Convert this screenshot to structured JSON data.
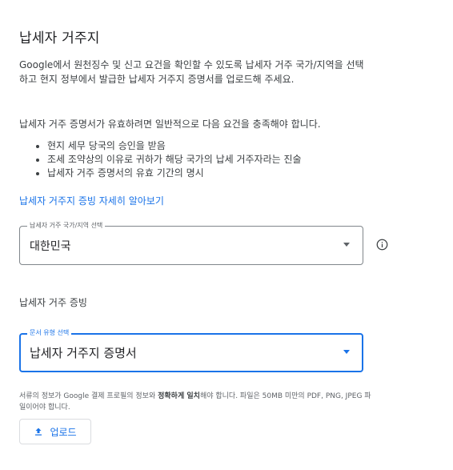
{
  "title": "납세자 거주지",
  "description": "Google에서 원천징수 및 신고 요건을 확인할 수 있도록 납세자 거주 국가/지역을 선택하고 현지 정부에서 발급한 납세자 거주지 증명서를 업로드해 주세요.",
  "requirements": {
    "intro": "납세자 거주 증명서가 유효하려면 일반적으로 다음 요건을 충족해야 합니다.",
    "items": [
      "현지 세무 당국의 승인을 받음",
      "조세 조약상의 이유로 귀하가 해당 국가의 납세 거주자라는 진술",
      "납세자 거주 증명서의 유효 기간의 명시"
    ]
  },
  "learn_more_link": "납세자 거주지 증빙 자세히 알아보기",
  "country_select": {
    "label": "납세자 거주 국가/지역 선택",
    "value": "대한민국"
  },
  "proof": {
    "label": "납세자 거주 증빙"
  },
  "doc_type_select": {
    "label": "문서 유형 선택",
    "value": "납세자 거주지 증명서"
  },
  "note": {
    "part1": "서류의 정보가 Google 결제 프로필의 정보와 ",
    "bold": "정확하게 일치",
    "part2": "해야 합니다. 파일은 50MB 미만의 PDF, PNG, JPEG 파일이어야 합니다."
  },
  "upload_button": {
    "label": "업로드"
  },
  "colors": {
    "accent": "#1a73e8",
    "text": "#202124",
    "muted": "#5f6368",
    "border": "#80868b"
  },
  "icons": {
    "info": "info-icon",
    "caret": "chevron-down-icon",
    "upload": "upload-icon"
  }
}
